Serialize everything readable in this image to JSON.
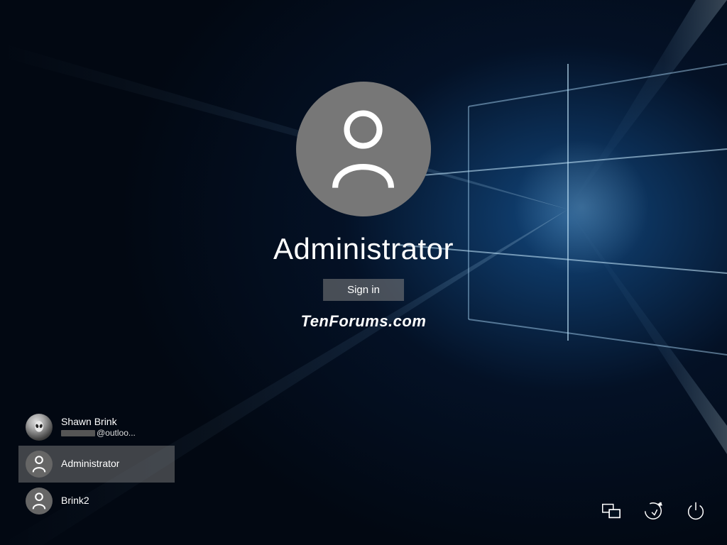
{
  "main_user": {
    "name": "Administrator",
    "signin_label": "Sign in"
  },
  "watermark": "TenForums.com",
  "user_list": [
    {
      "name": "Shawn Brink",
      "email_suffix": "@outloo...",
      "selected": false,
      "custom_avatar": true
    },
    {
      "name": "Administrator",
      "selected": true,
      "custom_avatar": false
    },
    {
      "name": "Brink2",
      "selected": false,
      "custom_avatar": false
    }
  ],
  "icons": {
    "network": "network-icon",
    "ease_of_access": "ease-of-access-icon",
    "power": "power-icon"
  }
}
